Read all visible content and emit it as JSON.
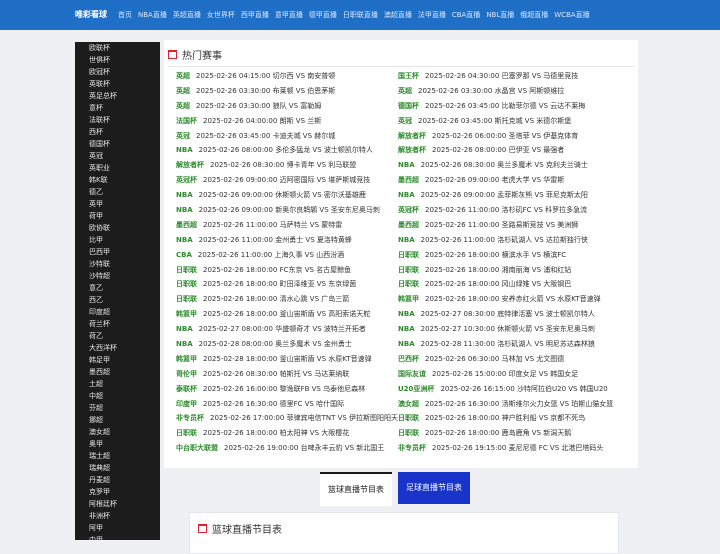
{
  "header": {
    "brand": "唯彩看球",
    "nav": [
      "首页",
      "NBA直播",
      "英超直播",
      "女世界杯",
      "西甲直播",
      "意甲直播",
      "德甲直播",
      "日职联直播",
      "澳超直播",
      "法甲直播",
      "CBA直播",
      "NBL直播",
      "俄超直播",
      "WCBA直播"
    ]
  },
  "sidebar": [
    "欧联杯",
    "世俱杯",
    "欧冠杯",
    "英联杯",
    "英足总杯",
    "意杯",
    "法联杯",
    "西杯",
    "德国杯",
    "英冠",
    "英职业",
    "韩K联",
    "德乙",
    "英甲",
    "荷甲",
    "欧协联",
    "比甲",
    "巴西甲",
    "沙特联",
    "沙特超",
    "意乙",
    "西乙",
    "印度超",
    "荷兰杯",
    "荷乙",
    "大西洋杯",
    "韩足甲",
    "墨西超",
    "土超",
    "中超",
    "芬超",
    "挪超",
    "澳女超",
    "奥甲",
    "瑞士超",
    "瑞典超",
    "丹麦超",
    "克罗甲",
    "阿根廷杯",
    "非洲杯",
    "阿甲",
    "中甲"
  ],
  "hot": {
    "title": "热门赛事",
    "left": [
      {
        "league": "英超",
        "text": "2025-02-26 04:15:00 切尔西 VS 南安普顿"
      },
      {
        "league": "英超",
        "text": "2025-02-26 03:30:00 布莱顿 VS 伯恩茅斯"
      },
      {
        "league": "英超",
        "text": "2025-02-26 03:30:00 狼队 VS 富勒姆"
      },
      {
        "league": "法国杯",
        "text": "2025-02-26 04:00:00 朗斯 VS 兰斯"
      },
      {
        "league": "英冠",
        "text": "2025-02-26 03:45:00 卡迪夫城 VS 赫尔城"
      },
      {
        "league": "NBA",
        "text": "2025-02-26 08:00:00 多伦多猛龙 VS 波士顿凯尔特人"
      },
      {
        "league": "解放者杯",
        "text": "2025-02-26 08:30:00 博卡青年 VS 利马联盟"
      },
      {
        "league": "英冠杯",
        "text": "2025-02-26 09:00:00 迈阿密国际 VS 堪萨斯城竞技"
      },
      {
        "league": "NBA",
        "text": "2025-02-26 09:00:00 休斯顿火箭 VS 密尔沃基雄鹿"
      },
      {
        "league": "NBA",
        "text": "2025-02-26 09:00:00 新奥尔良鹈鹕 VS 圣安东尼奥马刺"
      },
      {
        "league": "墨西超",
        "text": "2025-02-26 11:00:00 马萨特兰 VS 蒙特雷"
      },
      {
        "league": "NBA",
        "text": "2025-02-26 11:00:00 金州勇士 VS 夏洛特黄蜂"
      },
      {
        "league": "CBA",
        "text": "2025-02-26 11:00:00 上海久事 VS 山西汾酒"
      },
      {
        "league": "日职联",
        "text": "2025-02-26 18:00:00 FC东京 VS 名古屋鲸鱼"
      },
      {
        "league": "日职联",
        "text": "2025-02-26 18:00:00 町田泽维亚 VS 东京绿茵"
      },
      {
        "league": "日职联",
        "text": "2025-02-26 18:00:00 清水心跳 VS 广岛三箭"
      },
      {
        "league": "韩篮甲",
        "text": "2025-02-26 18:00:00 釜山宙斯盾 VS 高阳索诺天舵"
      },
      {
        "league": "NBA",
        "text": "2025-02-27 08:00:00 华盛顿奇才 VS 波特兰开拓者"
      },
      {
        "league": "NBA",
        "text": "2025-02-28 08:00:00 奥兰多魔术 VS 金州勇士"
      },
      {
        "league": "韩篮甲",
        "text": "2025-02-28 18:00:00 釜山宙斯盾 VS 水原KT音速弹"
      },
      {
        "league": "哥伦甲",
        "text": "2025-02-26 08:30:00 帕斯托 VS 马达莱纳联"
      },
      {
        "league": "泰联杯",
        "text": "2025-02-26 16:00:00 黎逸联FB VS 乌泰他尼森林"
      },
      {
        "league": "印度甲",
        "text": "2025-02-26 16:30:00 德里FC VS 哈什国际"
      },
      {
        "league": "非专员杯",
        "text": "2025-02-26 17:00:00 菲律宾电信TNT VS 伊拉斯图阳阳天"
      },
      {
        "league": "日职联",
        "text": "2025-02-26 18:00:00 柏太阳神 VS 大阪樱花"
      },
      {
        "league": "中台职大联盟",
        "text": "2025-02-26 19:00:00 台啤永丰云豹 VS 新北国王"
      }
    ],
    "right": [
      {
        "league": "国王杯",
        "text": "2025-02-26 04:30:00 巴塞罗那 VS 马德里竞技"
      },
      {
        "league": "英超",
        "text": "2025-02-26 03:30:00 水晶宫 VS 阿斯顿维拉"
      },
      {
        "league": "德国杯",
        "text": "2025-02-26 03:45:00 比勒菲尔德 VS 云达不莱梅"
      },
      {
        "league": "英冠",
        "text": "2025-02-26 03:45:00 斯托克城 VS 米德尔斯堡"
      },
      {
        "league": "解放者杯",
        "text": "2025-02-26 06:00:00 圣塔菲 VS 伊基克体育"
      },
      {
        "league": "解放者杯",
        "text": "2025-02-26 08:00:00 巴伊亚 VS 最强者"
      },
      {
        "league": "NBA",
        "text": "2025-02-26 08:30:00 奥兰多魔术 VS 克利夫兰骑士"
      },
      {
        "league": "墨西超",
        "text": "2025-02-26 09:00:00 老虎大学 VS 华雷斯"
      },
      {
        "league": "NBA",
        "text": "2025-02-26 09:00:00 孟菲斯灰熊 VS 菲尼克斯太阳"
      },
      {
        "league": "英冠杯",
        "text": "2025-02-26 11:00:00 洛杉矶FC VS 科罗拉多急流"
      },
      {
        "league": "墨西超",
        "text": "2025-02-26 11:00:00 圣路易斯竞技 VS 美洲狮"
      },
      {
        "league": "NBA",
        "text": "2025-02-26 11:00:00 洛杉矶湖人 VS 达拉斯独行侠"
      },
      {
        "league": "日职联",
        "text": "2025-02-26 18:00:00 横滨水手 VS 横滨FC"
      },
      {
        "league": "日职联",
        "text": "2025-02-26 18:00:00 湘南丽海 VS 浦和红钻"
      },
      {
        "league": "日职联",
        "text": "2025-02-26 18:00:00 冈山绿雉 VS 大阪钢巴"
      },
      {
        "league": "韩篮甲",
        "text": "2025-02-26 18:00:00 安养赤红火箭 VS 水原KT音速弹"
      },
      {
        "league": "NBA",
        "text": "2025-02-27 08:30:00 底特律活塞 VS 波士顿凯尔特人"
      },
      {
        "league": "NBA",
        "text": "2025-02-27 10:30:00 休斯顿火箭 VS 圣安东尼奥马刺"
      },
      {
        "league": "NBA",
        "text": "2025-02-28 11:30:00 洛杉矶湖人 VS 明尼苏达森林狼"
      },
      {
        "league": "巴西杯",
        "text": "2025-02-26 06:30:00 马林加 VS 尤文图德"
      },
      {
        "league": "国际友谊",
        "text": "2025-02-26 15:00:00 印度女足 VS 韩国女足"
      },
      {
        "league": "U20亚洲杯",
        "text": "2025-02-26 16:15:00 沙特阿拉伯U20 VS 韩国U20"
      },
      {
        "league": "澳女超",
        "text": "2025-02-26 16:30:00 汤斯维尔火力女篮 VS 珀斯山猫女篮"
      },
      {
        "league": "日职联",
        "text": "2025-02-26 18:00:00 神户胜利船 VS 京都不死鸟"
      },
      {
        "league": "日职联",
        "text": "2025-02-26 18:00:00 鹿岛鹿角 VS 新潟天鹅"
      },
      {
        "league": "非专员杯",
        "text": "2025-02-26 19:15:00 麦尼尼德 FC VS 北港巴塔码头"
      }
    ]
  },
  "tabs": [
    "篮球直播节目表",
    "足球直播节目表"
  ],
  "bottom": {
    "title": "篮球直播节目表"
  },
  "colors": {
    "topbar": "#1f6fc6",
    "league": "#2e8b2e",
    "active_tab": "#1a33c9",
    "icon": "#dd2233"
  }
}
